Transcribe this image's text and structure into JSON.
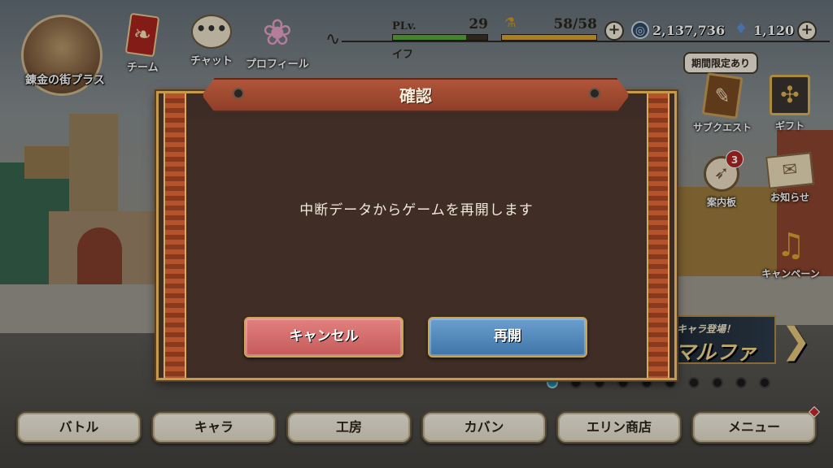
{
  "location": {
    "label": "錬金の街プラス"
  },
  "top_menu": [
    {
      "label": "チーム",
      "icon": "team-banner-icon"
    },
    {
      "label": "チャット",
      "icon": "chat-bubble-icon"
    },
    {
      "label": "プロフィール",
      "icon": "butterfly-icon"
    }
  ],
  "player": {
    "level_tag": "PLv.",
    "level": "29",
    "level_progress": 0.78,
    "name": "イフ",
    "stamina_text": "58/58",
    "stamina_progress": 1.0
  },
  "currency": {
    "coins": "2,137,736",
    "gems": "1,120"
  },
  "side_menu": {
    "limited_badge": "期間限定あり",
    "items": [
      {
        "label": "サブクエスト",
        "icon": "quill-book-icon"
      },
      {
        "label": "ギフト",
        "icon": "gift-box-icon"
      },
      {
        "label": "案内板",
        "icon": "compass-icon",
        "badge": "3"
      },
      {
        "label": "お知らせ",
        "icon": "letter-icon"
      },
      {
        "label": "キャンペーン",
        "icon": "bell-icon"
      }
    ]
  },
  "banner": {
    "subtitle": "キャラ登場！",
    "title": "マルファ"
  },
  "pager": {
    "count": 10,
    "active": 0
  },
  "bottom_nav": [
    "バトル",
    "キャラ",
    "工房",
    "カバン",
    "エリン商店",
    "メニュー"
  ],
  "dialog": {
    "title": "確認",
    "message": "中断データからゲームを再開します",
    "cancel_label": "キャンセル",
    "resume_label": "再開"
  },
  "colors": {
    "level_bar": "#5aa83a",
    "stamina_bar": "#d9a52b",
    "cancel_button": "#d36c6c",
    "resume_button": "#5086bb",
    "dialog_bg": "#3d2b25",
    "pager_active": "#28a7c4"
  }
}
